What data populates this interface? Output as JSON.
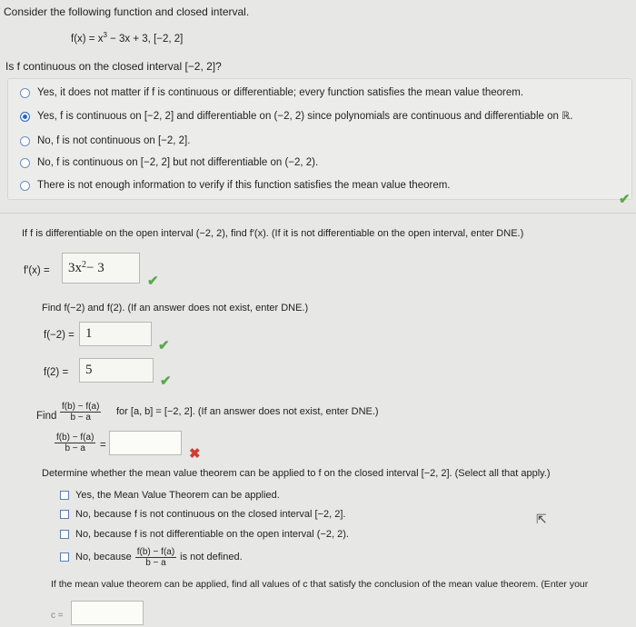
{
  "header": {
    "intro": "Consider the following function and closed interval.",
    "function": "f(x) = x",
    "function_exp": "3",
    "function_rest": " − 3x + 3,    [−2, 2]",
    "question1": "Is f continuous on the closed interval [−2, 2]?"
  },
  "options": [
    {
      "label": "Yes, it does not matter if f is continuous or differentiable; every function satisfies the mean value theorem.",
      "selected": false
    },
    {
      "label": "Yes, f is continuous on [−2, 2] and differentiable on (−2, 2) since polynomials are continuous and differentiable on ℝ.",
      "selected": true
    },
    {
      "label": "No, f is not continuous on [−2, 2].",
      "selected": false
    },
    {
      "label": "No, f is continuous on [−2, 2] but not differentiable on (−2, 2).",
      "selected": false
    },
    {
      "label": "There is not enough information to verify if this function satisfies the mean value theorem.",
      "selected": false
    }
  ],
  "derivative": {
    "question": "If f is differentiable on the open interval (−2, 2), find f′(x). (If it is not differentiable on the open interval, enter DNE.)",
    "label": "f′(x) =",
    "answer_base": "3x",
    "answer_exp": "2",
    "answer_rest": " − 3"
  },
  "values": {
    "question": "Find f(−2) and f(2). (If an answer does not exist, enter DNE.)",
    "f_neg2_label": "f(−2) =",
    "f_neg2_answer": "1",
    "f_2_label": "f(2) =",
    "f_2_answer": "5"
  },
  "difference": {
    "find_label": "Find",
    "frac_num": "f(b) − f(a)",
    "frac_den": "b − a",
    "question_rest": "for [a, b] = [−2, 2]. (If an answer does not exist, enter DNE.)",
    "eq": "=",
    "answer": ""
  },
  "mvt": {
    "question": "Determine whether the mean value theorem can be applied to f on the closed interval [−2, 2]. (Select all that apply.)",
    "choices": [
      "Yes, the Mean Value Theorem can be applied.",
      "No, because f is not continuous on the closed interval [−2, 2].",
      "No, because f is not differentiable on the open interval (−2, 2).",
      "No, because",
      "is not defined."
    ]
  },
  "cvalues": {
    "question": "If the mean value theorem can be applied, find all values of c that satisfy the conclusion of the mean value theorem. (Enter your",
    "label": "c =",
    "answer": ""
  },
  "colors": {
    "correct": "#5aa84a",
    "incorrect": "#d23b32",
    "selected_radio": "#2f66c6"
  }
}
